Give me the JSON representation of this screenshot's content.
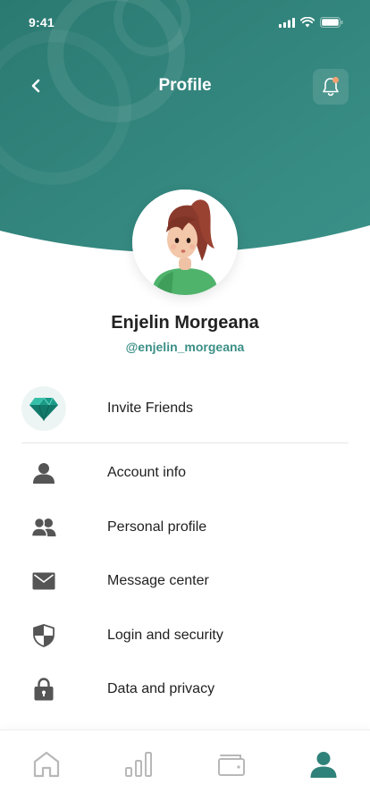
{
  "status_bar": {
    "time": "9:41"
  },
  "header": {
    "title": "Profile",
    "has_notification": true
  },
  "colors": {
    "header_bg": "#2f8279",
    "accent": "#3b8f86",
    "notification_dot": "#f2a272",
    "icon_gray": "#555555"
  },
  "user": {
    "name": "Enjelin Morgeana",
    "handle": "@enjelin_morgeana",
    "avatar": "avatar-illustration"
  },
  "invite": {
    "label": "Invite Friends",
    "icon": "gem-icon"
  },
  "menu": [
    {
      "label": "Account info",
      "icon": "user-icon"
    },
    {
      "label": "Personal profile",
      "icon": "users-icon"
    },
    {
      "label": "Message center",
      "icon": "mail-icon"
    },
    {
      "label": "Login and security",
      "icon": "shield-icon"
    },
    {
      "label": "Data and privacy",
      "icon": "lock-icon"
    }
  ],
  "tabbar": {
    "tabs": [
      {
        "name": "home",
        "icon": "home-icon"
      },
      {
        "name": "stats",
        "icon": "bar-chart-icon"
      },
      {
        "name": "wallet",
        "icon": "wallet-icon"
      },
      {
        "name": "profile",
        "icon": "profile-icon",
        "active": true
      }
    ]
  }
}
